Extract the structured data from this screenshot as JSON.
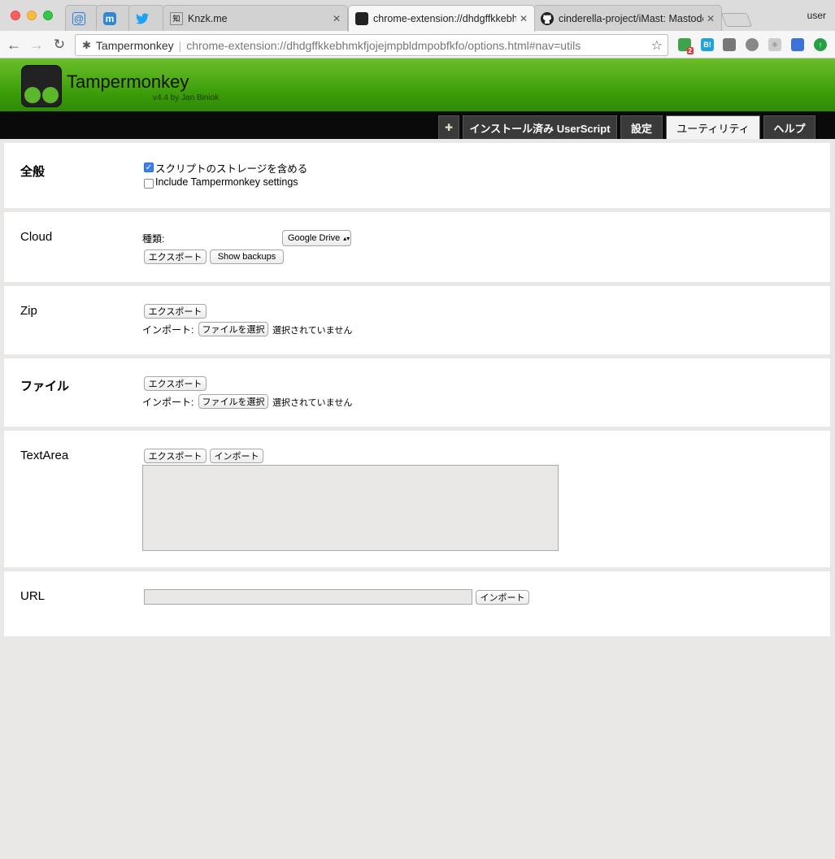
{
  "browser": {
    "tabs": [
      {
        "title": "",
        "icon": "at-icon"
      },
      {
        "title": "",
        "icon": "mastodon-icon"
      },
      {
        "title": "",
        "icon": "twitter-icon"
      },
      {
        "title": "Knzk.me",
        "icon": "knzk-icon"
      },
      {
        "title": "chrome-extension://dhdgffkkebhmkfjojejmpbldmpobfkfo/options.html#nav=utils",
        "icon": "tampermonkey-icon",
        "active": true
      },
      {
        "title": "cinderella-project/iMast: Mastodon",
        "icon": "github-icon"
      }
    ],
    "user": "user",
    "omnibox": {
      "ext_name": "Tampermonkey",
      "url": "chrome-extension://dhdgffkkebhmkfjojejmpbldmpobfkfo/options.html#nav=utils"
    },
    "ext_badge": "2"
  },
  "header": {
    "title": "Tampermonkey",
    "subtitle": "v4.4 by Jan Biniok"
  },
  "nav": {
    "installed": "インストール済み UserScript",
    "settings": "設定",
    "utilities": "ユーティリティ",
    "help": "ヘルプ"
  },
  "general": {
    "label": "全般",
    "include_storage": "スクリプトのストレージを含める",
    "include_storage_checked": true,
    "include_settings": "Include Tampermonkey settings",
    "include_settings_checked": false
  },
  "cloud": {
    "label": "Cloud",
    "type_label": "種類:",
    "type_value": "Google Drive",
    "export": "エクスポート",
    "show_backups": "Show backups"
  },
  "zip": {
    "label": "Zip",
    "export": "エクスポート",
    "import_label": "インポート:",
    "choose_file": "ファイルを選択",
    "no_file": "選択されていません"
  },
  "file": {
    "label": "ファイル",
    "export": "エクスポート",
    "import_label": "インポート:",
    "choose_file": "ファイルを選択",
    "no_file": "選択されていません"
  },
  "textarea": {
    "label": "TextArea",
    "export": "エクスポート",
    "import": "インポート",
    "value": ""
  },
  "url": {
    "label": "URL",
    "value": "",
    "import": "インポート"
  }
}
